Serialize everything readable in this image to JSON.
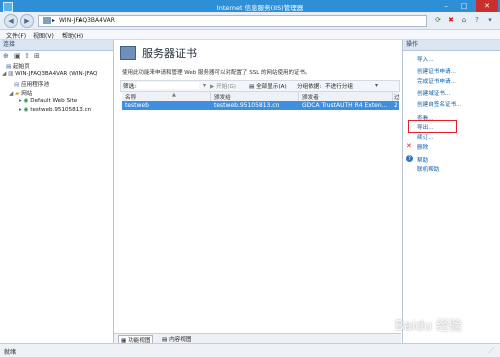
{
  "window": {
    "title": "Internet 信息服务(IIS)管理器"
  },
  "address": {
    "path": "WIN-JFAQ3BA4VAR",
    "arrow": "▸"
  },
  "menu": [
    "文件(F)",
    "视图(V)",
    "帮助(H)"
  ],
  "left": {
    "header": "连接",
    "tree": [
      {
        "label": "起始页"
      },
      {
        "label": "WIN-JFAQ3BA4VAR (WIN-JFAQ"
      },
      {
        "label": "应用程序池"
      },
      {
        "label": "网站"
      },
      {
        "label": "Default Web Site"
      },
      {
        "label": "testweb.95105813.cn"
      }
    ]
  },
  "center": {
    "title": "服务器证书",
    "description": "使用此功能来申请和管理 Web 服务器可以对配置了 SSL 的网站使用的证书。",
    "filter_label": "筛选:",
    "start_label": "开始(G)",
    "show_all_label": "全部显示(A)",
    "group_by_label": "分组依据:",
    "group_by_value": "不进行分组",
    "columns": [
      "名称",
      "颁发给",
      "颁发者",
      "过"
    ],
    "rows": [
      {
        "name": "testweb",
        "issued_to": "testweb.95105813.cn",
        "issuer": "GDCA TrustAUTH R4 Exten...",
        "exp": "2"
      }
    ],
    "view_tabs": [
      "功能视图",
      "内容视图"
    ]
  },
  "right": {
    "header": "操作",
    "actions": [
      "导入...",
      "创建证书申请...",
      "完成证书申请...",
      "创建域证书...",
      "创建自签名证书...",
      "查看...",
      "导出...",
      "续订...",
      "删除",
      "帮助",
      "联机帮助"
    ]
  },
  "status": {
    "text": "就绪"
  },
  "watermark": "Baidu 经验",
  "colors": {
    "titlebar": "#2f8fd6",
    "selection": "#3f8fe0",
    "highlight_box": "#e0202a",
    "link": "#0b5ea8"
  }
}
